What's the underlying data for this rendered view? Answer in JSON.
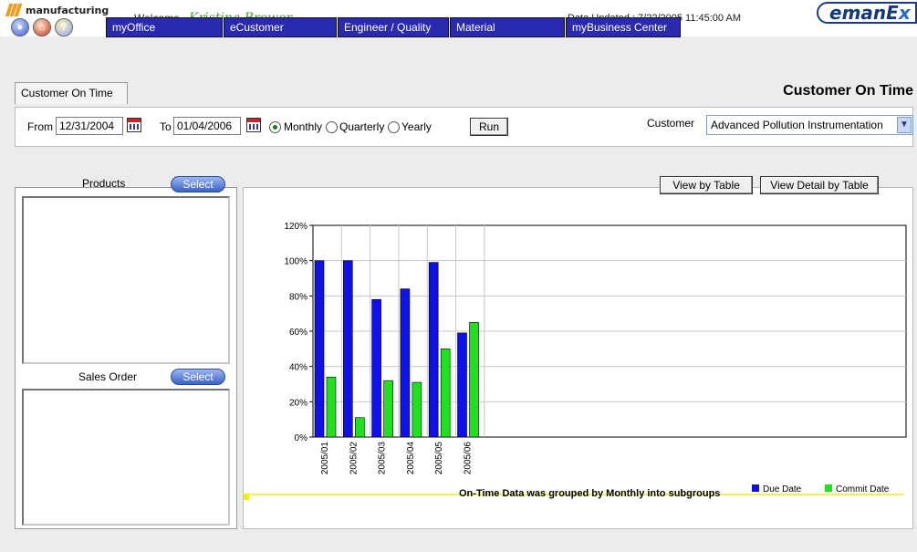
{
  "header": {
    "brand": "manufacturing",
    "welcome_label": "Welcome",
    "user_name": "Kristina Brower",
    "data_updated": "Data Updated ;  7/22/2005 11:45:00 AM",
    "logo_main": "emanE",
    "logo_x": "x"
  },
  "nav": {
    "tabs": [
      "myOffice",
      "eCustomer",
      "Engineer / Quality",
      "Material",
      "myBusiness Center"
    ]
  },
  "page": {
    "tab_label": "Customer On Time",
    "title": "Customer On Time"
  },
  "filters": {
    "from_label": "From",
    "from_value": "12/31/2004",
    "to_label": "To",
    "to_value": "01/04/2006",
    "period_options": [
      "Monthly",
      "Quarterly",
      "Yearly"
    ],
    "period_selected": "Monthly",
    "run_label": "Run",
    "customer_label": "Customer",
    "customer_value": "Advanced Pollution Instrumentation"
  },
  "left_panel": {
    "products_label": "Products",
    "sales_order_label": "Sales Order",
    "select_label": "Select"
  },
  "right_panel": {
    "view_table_label": "View by Table",
    "view_detail_label": "View Detail by Table",
    "footnote": "On-Time Data was grouped by Monthly into subgroups"
  },
  "colors": {
    "nav_bg": "#2a2ab0",
    "due": "#1010e8",
    "commit": "#20e020"
  },
  "chart_data": {
    "type": "bar",
    "categories": [
      "2005/01",
      "2005/02",
      "2005/03",
      "2005/04",
      "2005/05",
      "2005/06"
    ],
    "series": [
      {
        "name": "Due Date",
        "values": [
          100,
          100,
          78,
          84,
          99,
          59
        ]
      },
      {
        "name": "Commit Date",
        "values": [
          34,
          11,
          32,
          31,
          50,
          65
        ]
      }
    ],
    "yticks": [
      "0%",
      "20%",
      "40%",
      "60%",
      "80%",
      "100%",
      "120%"
    ],
    "ylim": [
      0,
      120
    ],
    "grid": true,
    "legend": "bottom-right"
  }
}
